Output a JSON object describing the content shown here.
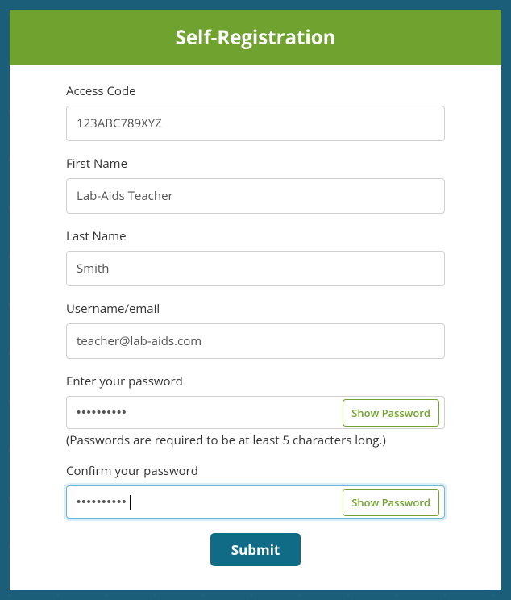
{
  "header": {
    "title": "Self-Registration"
  },
  "form": {
    "access_code": {
      "label": "Access Code",
      "value": "123ABC789XYZ"
    },
    "first_name": {
      "label": "First Name",
      "value": "Lab-Aids Teacher"
    },
    "last_name": {
      "label": "Last Name",
      "value": "Smith"
    },
    "username": {
      "label": "Username/email",
      "value": "teacher@lab-aids.com"
    },
    "password": {
      "label": "Enter your password",
      "value": "••••••••••",
      "show_label": "Show Password",
      "hint": "(Passwords are required to be at least 5 characters long.)"
    },
    "confirm_password": {
      "label": "Confirm your password",
      "value": "••••••••••",
      "show_label": "Show Password"
    },
    "submit_label": "Submit"
  }
}
